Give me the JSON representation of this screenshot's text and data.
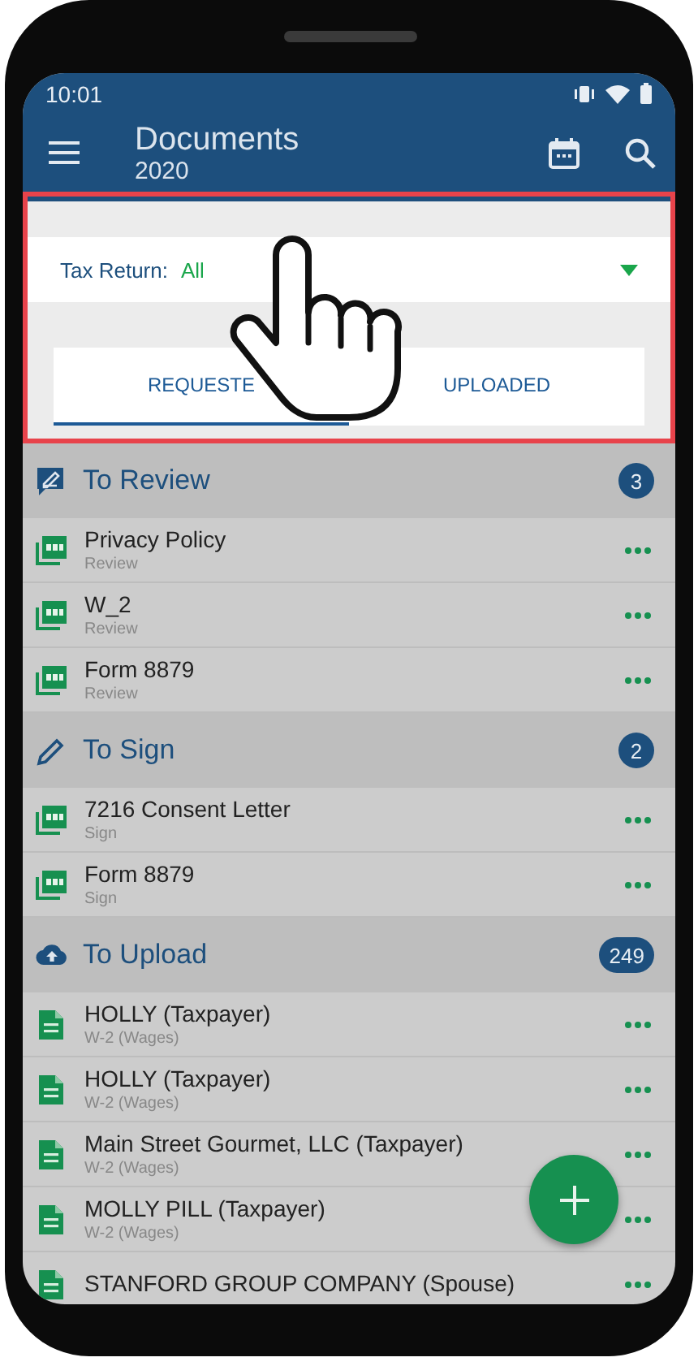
{
  "status_bar": {
    "time": "10:01"
  },
  "app_bar": {
    "title": "Documents",
    "subtitle": "2020"
  },
  "filter": {
    "label": "Tax Return:",
    "value": "All"
  },
  "tabs": [
    {
      "label": "REQUESTE",
      "selected": true
    },
    {
      "label": "UPLOADED",
      "selected": false
    }
  ],
  "sections": [
    {
      "kind": "review",
      "title": "To Review",
      "count": "3",
      "items": [
        {
          "kind": "pdf",
          "name": "Privacy Policy",
          "type": "Review"
        },
        {
          "kind": "pdf",
          "name": "W_2",
          "type": "Review"
        },
        {
          "kind": "pdf",
          "name": "Form 8879",
          "type": "Review"
        }
      ]
    },
    {
      "kind": "sign",
      "title": "To Sign",
      "count": "2",
      "items": [
        {
          "kind": "pdf",
          "name": "7216 Consent Letter",
          "type": "Sign"
        },
        {
          "kind": "pdf",
          "name": "Form 8879",
          "type": "Sign"
        }
      ]
    },
    {
      "kind": "upload",
      "title": "To Upload",
      "count": "249",
      "items": [
        {
          "kind": "doc",
          "name": "HOLLY (Taxpayer)",
          "type": "W-2 (Wages)"
        },
        {
          "kind": "doc",
          "name": "HOLLY (Taxpayer)",
          "type": "W-2 (Wages)"
        },
        {
          "kind": "doc",
          "name": "Main Street Gourmet, LLC (Taxpayer)",
          "type": "W-2 (Wages)"
        },
        {
          "kind": "doc",
          "name": "MOLLY PILL (Taxpayer)",
          "type": "W-2 (Wages)"
        },
        {
          "kind": "doc",
          "name": "STANFORD GROUP COMPANY (Spouse)"
        }
      ]
    }
  ]
}
